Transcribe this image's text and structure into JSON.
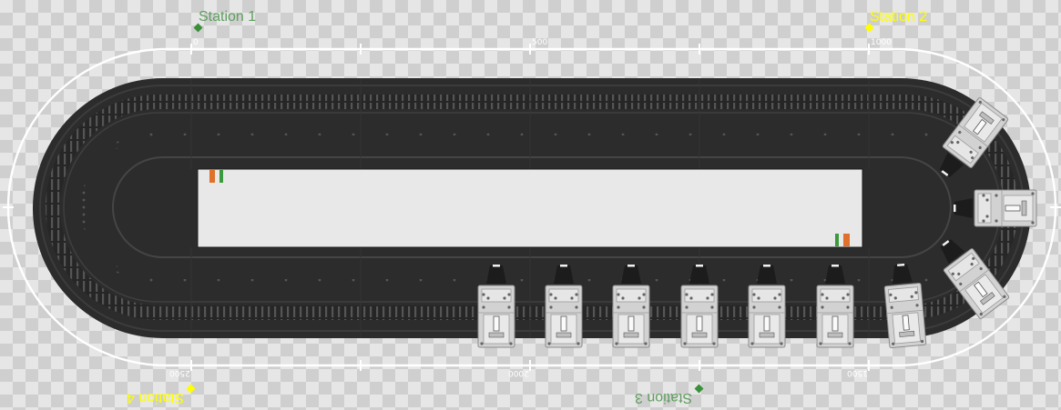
{
  "colors": {
    "station_active": "#ffff00",
    "station_inactive": "#5f9e5f",
    "track_dark": "#2c2c2c",
    "track_rim": "#3a3a3a",
    "path_line": "#ffffff",
    "marker_green": "#3a8f3a",
    "marker_yellow": "#ffff00",
    "indicator_orange": "#e0712a",
    "indicator_green": "#3b9a3b"
  },
  "stations": [
    {
      "label": "Station 1",
      "state": "inactive"
    },
    {
      "label": "Station 2",
      "state": "active"
    },
    {
      "label": "Station 3",
      "state": "inactive"
    },
    {
      "label": "Station 4",
      "state": "active"
    }
  ],
  "position_ticks": [
    "0",
    "500",
    "1000",
    "1500",
    "2000",
    "2500"
  ],
  "movers": {
    "count": 10,
    "icon": "mover-carriage-icon"
  }
}
